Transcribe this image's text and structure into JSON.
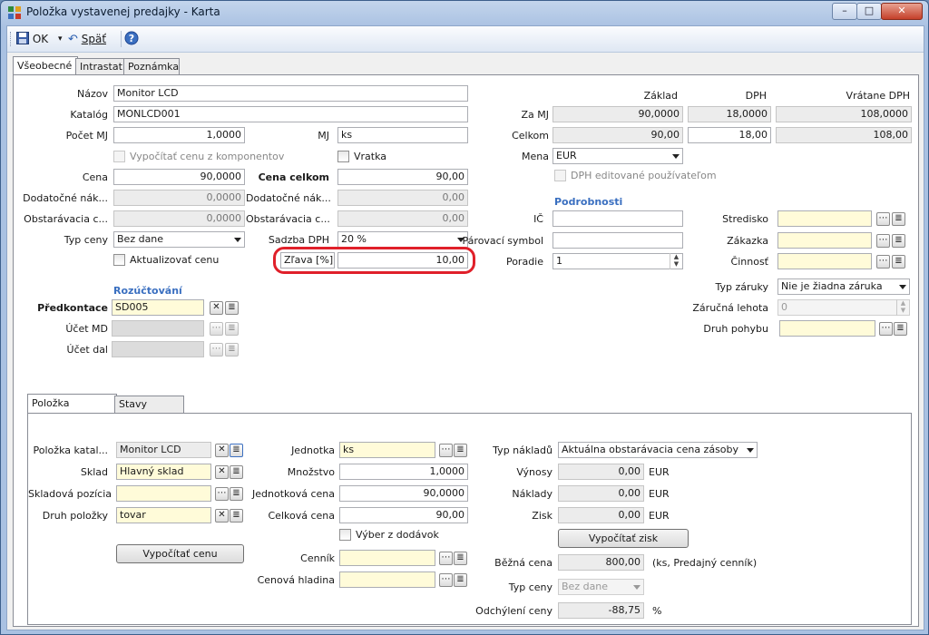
{
  "window": {
    "title": "Položka vystavenej predajky - Karta"
  },
  "toolbar": {
    "ok_label": "OK",
    "back_label": "Späť"
  },
  "tabs": [
    {
      "label": "Všeobecné"
    },
    {
      "label": "Intrastat"
    },
    {
      "label": "Poznámka"
    }
  ],
  "general": {
    "nazov": {
      "label": "Názov",
      "value": "Monitor LCD"
    },
    "katalog": {
      "label": "Katalóg",
      "value": "MONLCD001"
    },
    "pocet_mj": {
      "label": "Počet MJ",
      "value": "1,0000"
    },
    "mj": {
      "label": "MJ",
      "value": "ks"
    },
    "vypocitat_z_komponentov": {
      "label": "Vypočítať cenu z komponentov"
    },
    "vratka": {
      "label": "Vratka"
    },
    "cena": {
      "label": "Cena",
      "value": "90,0000"
    },
    "cena_celkom": {
      "label": "Cena celkom",
      "value": "90,00"
    },
    "dodatocne_left": {
      "label": "Dodatočné nák...",
      "value": "0,0000"
    },
    "dodatocne_right": {
      "label": "Dodatočné nák...",
      "value": "0,00"
    },
    "obstaravacia_left": {
      "label": "Obstarávacia c...",
      "value": "0,0000"
    },
    "obstaravacia_right": {
      "label": "Obstarávacia c...",
      "value": "0,00"
    },
    "typ_ceny": {
      "label": "Typ ceny",
      "value": "Bez dane"
    },
    "sadzba_dph": {
      "label": "Sadzba DPH",
      "value": "20 %"
    },
    "aktualizovat_cenu": {
      "label": "Aktualizovať cenu"
    },
    "zlava": {
      "label": "Zľava [%]",
      "value": "10,00"
    }
  },
  "price_grid": {
    "headers": [
      "Základ",
      "DPH",
      "Vrátane DPH"
    ],
    "za_mj": {
      "label": "Za MJ",
      "values": [
        "90,0000",
        "18,0000",
        "108,0000"
      ]
    },
    "celkom": {
      "label": "Celkom",
      "values": [
        "90,00",
        "18,00",
        "108,00"
      ]
    },
    "mena": {
      "label": "Mena",
      "value": "EUR"
    },
    "dph_editovane": {
      "label": "DPH editované používateľom"
    }
  },
  "podrobnosti": {
    "header": "Podrobnosti",
    "ic": {
      "label": "IČ",
      "value": ""
    },
    "parovaci_symbol": {
      "label": "Párovací symbol",
      "value": ""
    },
    "poradie": {
      "label": "Poradie",
      "value": "1"
    },
    "stredisko": {
      "label": "Stredisko"
    },
    "zakazka": {
      "label": "Zákazka"
    },
    "cinnost": {
      "label": "Činnosť"
    },
    "typ_zaruky": {
      "label": "Typ záruky",
      "value": "Nie je žiadna záruka"
    },
    "zarucna_lehota": {
      "label": "Záručná lehota",
      "value": "0"
    },
    "druh_pohybu": {
      "label": "Druh pohybu"
    }
  },
  "rozuctovani": {
    "header": "Rozúčtování",
    "predkontace": {
      "label": "Předkontace",
      "value": "SD005"
    },
    "ucet_md": {
      "label": "Účet MD"
    },
    "ucet_dal": {
      "label": "Účet dal"
    }
  },
  "subtabs": [
    {
      "label": "Položka katalógu"
    },
    {
      "label": "Stavy zásoby"
    }
  ],
  "katalog_tab": {
    "polozka_katalogu": {
      "label": "Položka katal...",
      "value": "Monitor LCD"
    },
    "sklad": {
      "label": "Sklad",
      "value": "Hlavný sklad"
    },
    "skladova_pozicia": {
      "label": "Skladová pozícia",
      "value": ""
    },
    "druh_polozky": {
      "label": "Druh položky",
      "value": "tovar"
    },
    "vypocitat_cenu_btn": "Vypočítať cenu",
    "jednotka": {
      "label": "Jednotka",
      "value": "ks"
    },
    "mnozstvo": {
      "label": "Množstvo",
      "value": "1,0000"
    },
    "jednotkova_cena": {
      "label": "Jednotková cena",
      "value": "90,0000"
    },
    "celkova_cena": {
      "label": "Celková cena",
      "value": "90,00"
    },
    "vyber_z_dodavok": {
      "label": "Výber z dodávok"
    },
    "cennik": {
      "label": "Cenník"
    },
    "cenova_hladina": {
      "label": "Cenová hladina"
    },
    "typ_nakladu": {
      "label": "Typ nákladů",
      "value": "Aktuálna obstarávacia cena zásoby"
    },
    "vynosy": {
      "label": "Výnosy",
      "value": "0,00",
      "unit": "EUR"
    },
    "naklady": {
      "label": "Náklady",
      "value": "0,00",
      "unit": "EUR"
    },
    "zisk": {
      "label": "Zisk",
      "value": "0,00",
      "unit": "EUR"
    },
    "vypocitat_zisk_btn": "Vypočítať zisk",
    "bezna_cena": {
      "label": "Běžná cena",
      "value": "800,00",
      "note": "(ks, Predajný cenník)"
    },
    "typ_ceny": {
      "label": "Typ ceny",
      "value": "Bez dane"
    },
    "odchyleni_ceny": {
      "label": "Odchýlení ceny",
      "value": "-88,75",
      "unit": "%"
    }
  }
}
